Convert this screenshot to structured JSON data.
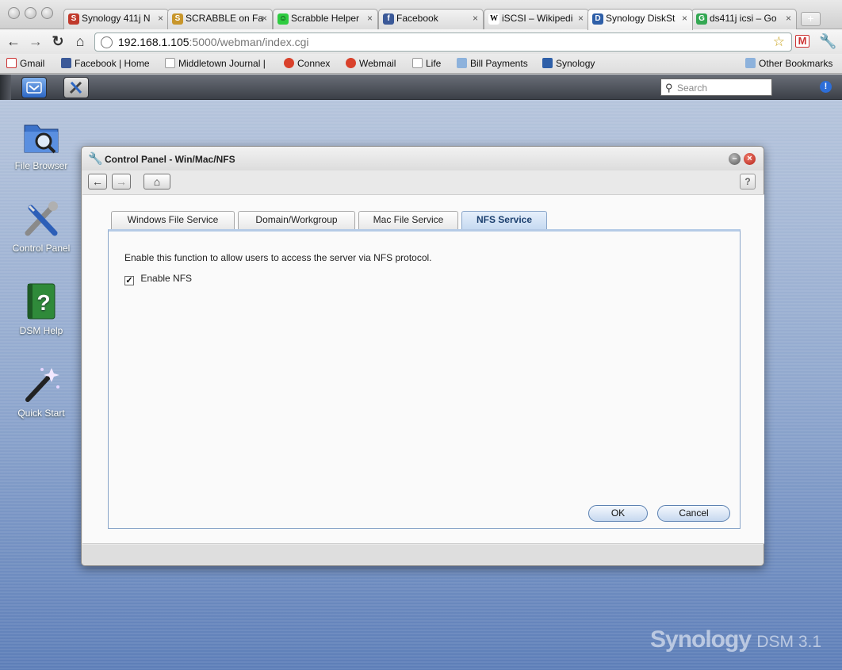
{
  "browser": {
    "tabs": [
      {
        "label": "Synology 411j N",
        "color": "#c0392b",
        "glyph": "S"
      },
      {
        "label": "SCRABBLE on Fa",
        "color": "#c8962b",
        "glyph": "S"
      },
      {
        "label": "Scrabble Helper",
        "color": "#2ecc40",
        "glyph": "☺"
      },
      {
        "label": "Facebook",
        "color": "#3b5998",
        "glyph": "f"
      },
      {
        "label": "iSCSI – Wikipedi",
        "color": "#ffffff",
        "glyph": "W"
      },
      {
        "label": "Synology DiskSt",
        "color": "#2e5fa8",
        "glyph": "D"
      },
      {
        "label": "ds411j icsi – Go",
        "color": "#34a853",
        "glyph": "G"
      }
    ],
    "close_glyph": "×",
    "url_host": "192.168.1.105",
    "url_port": ":5000",
    "url_path": "/webman/index.cgi",
    "bookmarks": [
      {
        "label": "Gmail"
      },
      {
        "label": "Facebook | Home"
      },
      {
        "label": "Middletown Journal |"
      },
      {
        "label": "Connex"
      },
      {
        "label": "Webmail"
      },
      {
        "label": "Life"
      },
      {
        "label": "Bill Payments"
      },
      {
        "label": "Synology"
      }
    ],
    "other_bookmarks": "Other Bookmarks"
  },
  "taskbar": {
    "search_placeholder": "Search"
  },
  "desktop": {
    "icons": [
      {
        "label": "File Browser"
      },
      {
        "label": "Control Panel"
      },
      {
        "label": "DSM Help"
      },
      {
        "label": "Quick Start"
      }
    ],
    "brand": "Synology",
    "brand_version": "DSM 3.1"
  },
  "window": {
    "title": "Control Panel - Win/Mac/NFS",
    "tabs": [
      {
        "label": "Windows File Service"
      },
      {
        "label": "Domain/Workgroup"
      },
      {
        "label": "Mac File Service"
      },
      {
        "label": "NFS Service"
      }
    ],
    "active_tab": "NFS Service",
    "description": "Enable this function to allow users to access the server via NFS protocol.",
    "checkbox_label": "Enable NFS",
    "checkbox_checked": true,
    "check_glyph": "✓",
    "ok_label": "OK",
    "cancel_label": "Cancel",
    "help_glyph": "?"
  }
}
